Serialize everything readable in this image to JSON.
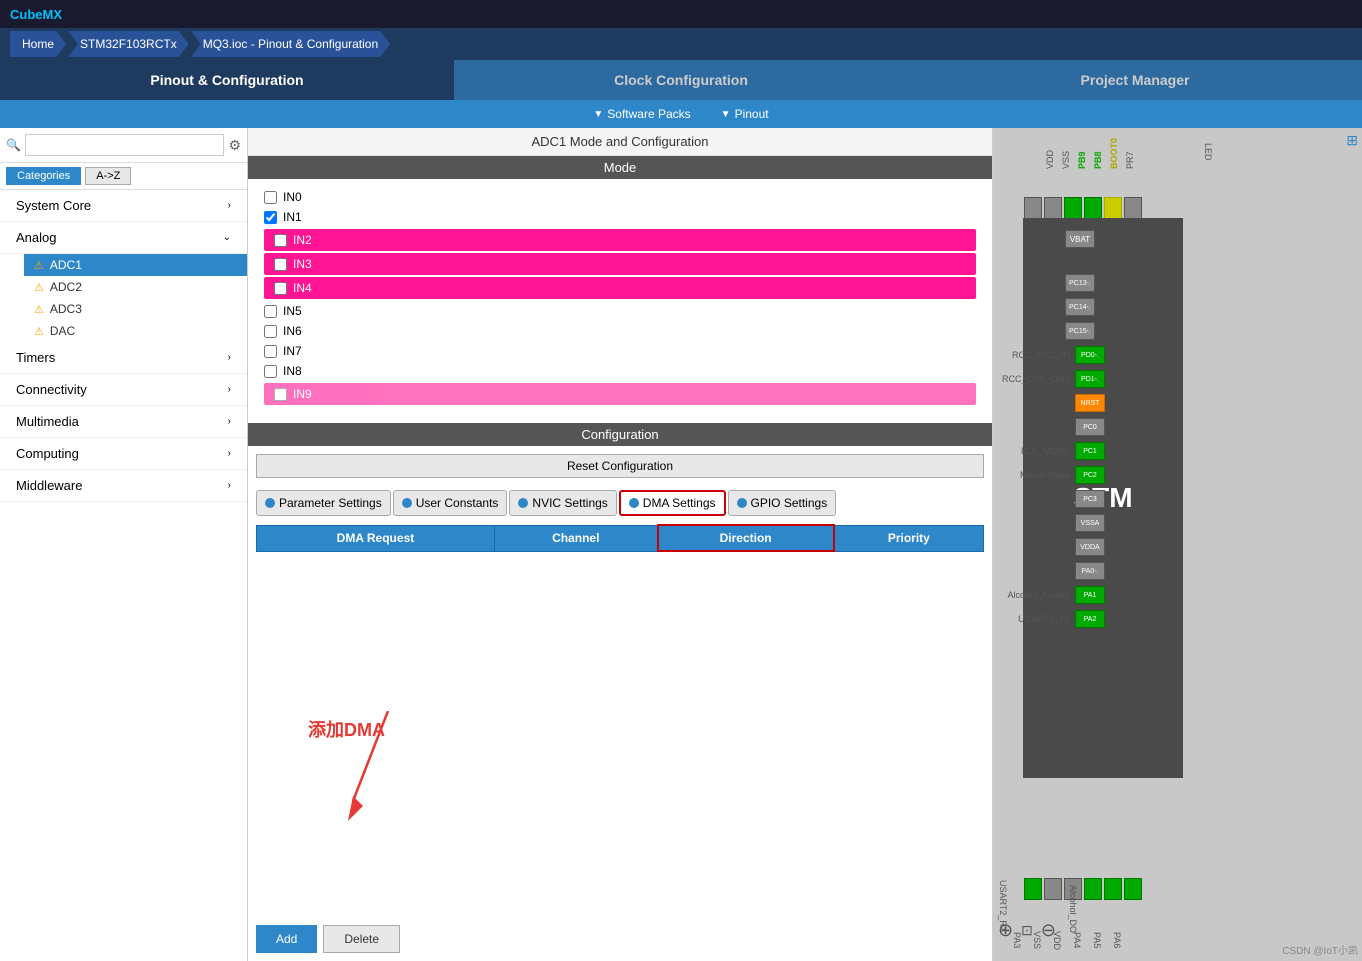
{
  "app": {
    "title": "CubeMX"
  },
  "breadcrumb": {
    "items": [
      "Home",
      "STM32F103RCTx",
      "MQ3.ioc - Pinout & Configuration"
    ]
  },
  "main_tabs": {
    "tab1": "Pinout & Configuration",
    "tab2": "Clock Configuration",
    "tab3": "Project Manager"
  },
  "sub_tabs": {
    "item1": "Software Packs",
    "item2": "Pinout"
  },
  "sidebar": {
    "search_placeholder": "",
    "tab1": "Categories",
    "tab2": "A->Z",
    "items": [
      {
        "label": "System Core",
        "has_children": true
      },
      {
        "label": "Analog",
        "has_children": true,
        "expanded": true
      },
      {
        "label": "Timers",
        "has_children": true
      },
      {
        "label": "Connectivity",
        "has_children": true
      },
      {
        "label": "Multimedia",
        "has_children": true
      },
      {
        "label": "Computing",
        "has_children": true
      },
      {
        "label": "Middleware",
        "has_children": true
      }
    ],
    "analog_children": [
      {
        "label": "ADC1",
        "warn": true,
        "selected": true
      },
      {
        "label": "ADC2",
        "warn": true
      },
      {
        "label": "ADC3",
        "warn": true
      },
      {
        "label": "DAC",
        "warn": true
      }
    ]
  },
  "content": {
    "title": "ADC1 Mode and Configuration",
    "mode_header": "Mode",
    "checkboxes": [
      {
        "label": "IN0",
        "checked": false,
        "highlighted": false
      },
      {
        "label": "IN1",
        "checked": true,
        "highlighted": false
      },
      {
        "label": "IN2",
        "checked": false,
        "highlighted": true
      },
      {
        "label": "IN3",
        "checked": false,
        "highlighted": true
      },
      {
        "label": "IN4",
        "checked": false,
        "highlighted": true
      },
      {
        "label": "IN5",
        "checked": false,
        "highlighted": false
      },
      {
        "label": "IN6",
        "checked": false,
        "highlighted": false
      },
      {
        "label": "IN7",
        "checked": false,
        "highlighted": false
      },
      {
        "label": "IN8",
        "checked": false,
        "highlighted": false
      },
      {
        "label": "IN9",
        "checked": false,
        "highlighted": true
      }
    ],
    "config_header": "Configuration",
    "reset_btn": "Reset Configuration",
    "tabs": [
      {
        "label": "Parameter Settings",
        "has_dot": true,
        "active": false
      },
      {
        "label": "User Constants",
        "has_dot": true,
        "active": false
      },
      {
        "label": "NVIC Settings",
        "has_dot": true,
        "active": false
      },
      {
        "label": "DMA Settings",
        "has_dot": true,
        "active": true
      },
      {
        "label": "GPIO Settings",
        "has_dot": true,
        "active": false
      }
    ],
    "dma_columns": [
      "DMA Request",
      "Channel",
      "Direction",
      "Priority"
    ],
    "add_btn": "Add",
    "delete_btn": "Delete",
    "annotation_text": "添加DMA"
  },
  "right_panel": {
    "pins_left": [
      "RCC_OSC_IN",
      "RCC_OSC_OUT",
      "",
      "BLE_MODE",
      "MasterSlave",
      "",
      "",
      "",
      "",
      "Alcohol_Analog",
      "USART2_TX"
    ],
    "pins_right_labels": [
      "PD0-.",
      "PD1-.",
      "NRST",
      "PC0",
      "PC1",
      "PC2",
      "PC3",
      "VSSA",
      "VDDA",
      "PA0-.",
      "PA1",
      "PA2"
    ],
    "pins_top": [
      "VDD",
      "VSS",
      "PB9",
      "PB8",
      "BOOT0",
      "PR7"
    ],
    "pins_bottom": [
      "PA3",
      "VSS",
      "VDD",
      "PA4",
      "PA5",
      "PA6"
    ],
    "bottom_labels": [
      "USART2_RX",
      "Alcohol_DO"
    ],
    "chip_label": "STM",
    "watermark": "CSDN @IoT小凯",
    "led_label": "LED"
  },
  "zoom_controls": {
    "zoom_in": "+",
    "fit": "⊡",
    "zoom_out": "-"
  }
}
